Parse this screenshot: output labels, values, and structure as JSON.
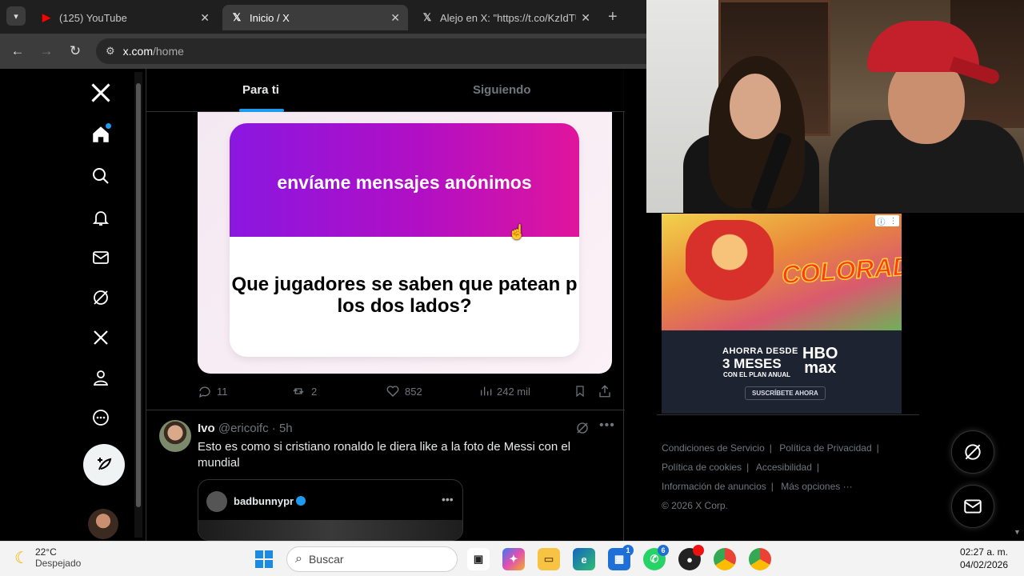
{
  "browser": {
    "tabs": [
      {
        "title": "(125) YouTube",
        "active": false,
        "icon": "youtube-icon"
      },
      {
        "title": "Inicio / X",
        "active": true,
        "icon": "x-logo-icon"
      },
      {
        "title": "Alejo en X: \"https://t.co/KzIdTU",
        "active": false,
        "icon": "x-logo-icon"
      }
    ],
    "url_host": "x.com",
    "url_path": "/home"
  },
  "feed": {
    "tabs": [
      "Para ti",
      "Siguiendo"
    ],
    "post1": {
      "card_header": "envíame mensajes anónimos",
      "card_question": "Que jugadores se saben que patean p los dos lados?",
      "replies": "11",
      "reposts": "2",
      "likes": "852",
      "views": "242 mil"
    },
    "post2": {
      "name": "Ivo",
      "handle": "@ericoifc",
      "time": "5h",
      "text": "Esto es como si cristiano ronaldo le diera like a la foto de Messi con el mundial",
      "quote_name": "badbunnypr"
    }
  },
  "ad": {
    "logo": "COLORADO",
    "line1": "AHORRA DESDE",
    "line2": "3 MESES",
    "line3": "CON EL PLAN ANUAL",
    "brand1": "HBO",
    "brand2": "max",
    "cta": "SUSCRÍBETE AHORA"
  },
  "footer": {
    "links": [
      "Condiciones de Servicio",
      "Política de Privacidad",
      "Política de cookies",
      "Accesibilidad",
      "Información de anuncios",
      "Más opciones ···"
    ],
    "copyright": "© 2026 X Corp."
  },
  "taskbar": {
    "temperature": "22°C",
    "weather": "Despejado",
    "search_placeholder": "Buscar",
    "time": "02:27 a. m.",
    "date": "04/02/2026",
    "badges": {
      "store": "1",
      "whatsapp": "6"
    }
  },
  "colors": {
    "accent": "#1d9bf0",
    "ngl_start": "#8a17e0",
    "ngl_end": "#e0159d"
  }
}
